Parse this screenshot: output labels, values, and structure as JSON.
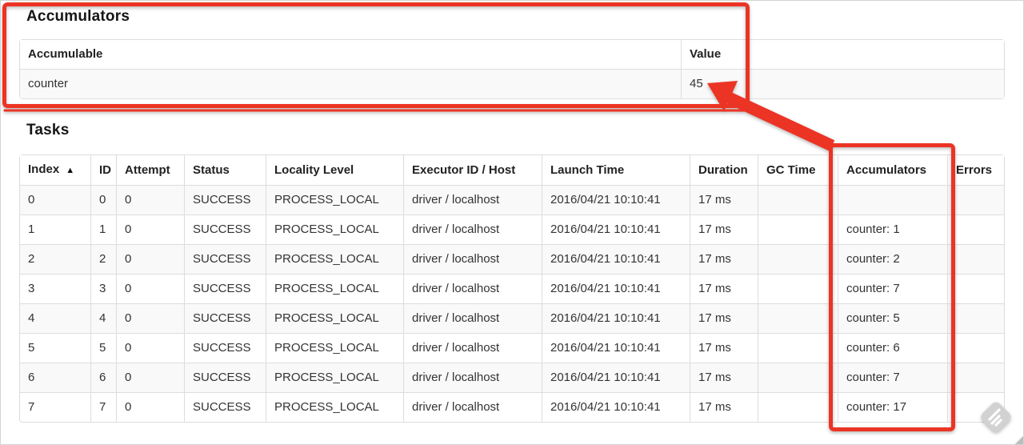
{
  "accumulators_section": {
    "heading": "Accumulators",
    "table": {
      "headers": {
        "accumulable": "Accumulable",
        "value": "Value"
      },
      "rows": [
        {
          "accumulable": "counter",
          "value": "45"
        }
      ]
    }
  },
  "tasks_section": {
    "heading": "Tasks",
    "table": {
      "sort_icon": "▲",
      "headers": {
        "index": "Index",
        "id": "ID",
        "attempt": "Attempt",
        "status": "Status",
        "locality": "Locality Level",
        "executor": "Executor ID / Host",
        "launch": "Launch Time",
        "duration": "Duration",
        "gc": "GC Time",
        "accum": "Accumulators",
        "errors": "Errors"
      },
      "rows": [
        {
          "index": "0",
          "id": "0",
          "attempt": "0",
          "status": "SUCCESS",
          "locality": "PROCESS_LOCAL",
          "executor": "driver / localhost",
          "launch": "2016/04/21 10:10:41",
          "duration": "17 ms",
          "gc": "",
          "accum": "",
          "errors": ""
        },
        {
          "index": "1",
          "id": "1",
          "attempt": "0",
          "status": "SUCCESS",
          "locality": "PROCESS_LOCAL",
          "executor": "driver / localhost",
          "launch": "2016/04/21 10:10:41",
          "duration": "17 ms",
          "gc": "",
          "accum": "counter: 1",
          "errors": ""
        },
        {
          "index": "2",
          "id": "2",
          "attempt": "0",
          "status": "SUCCESS",
          "locality": "PROCESS_LOCAL",
          "executor": "driver / localhost",
          "launch": "2016/04/21 10:10:41",
          "duration": "17 ms",
          "gc": "",
          "accum": "counter: 2",
          "errors": ""
        },
        {
          "index": "3",
          "id": "3",
          "attempt": "0",
          "status": "SUCCESS",
          "locality": "PROCESS_LOCAL",
          "executor": "driver / localhost",
          "launch": "2016/04/21 10:10:41",
          "duration": "17 ms",
          "gc": "",
          "accum": "counter: 7",
          "errors": ""
        },
        {
          "index": "4",
          "id": "4",
          "attempt": "0",
          "status": "SUCCESS",
          "locality": "PROCESS_LOCAL",
          "executor": "driver / localhost",
          "launch": "2016/04/21 10:10:41",
          "duration": "17 ms",
          "gc": "",
          "accum": "counter: 5",
          "errors": ""
        },
        {
          "index": "5",
          "id": "5",
          "attempt": "0",
          "status": "SUCCESS",
          "locality": "PROCESS_LOCAL",
          "executor": "driver / localhost",
          "launch": "2016/04/21 10:10:41",
          "duration": "17 ms",
          "gc": "",
          "accum": "counter: 6",
          "errors": ""
        },
        {
          "index": "6",
          "id": "6",
          "attempt": "0",
          "status": "SUCCESS",
          "locality": "PROCESS_LOCAL",
          "executor": "driver / localhost",
          "launch": "2016/04/21 10:10:41",
          "duration": "17 ms",
          "gc": "",
          "accum": "counter: 7",
          "errors": ""
        },
        {
          "index": "7",
          "id": "7",
          "attempt": "0",
          "status": "SUCCESS",
          "locality": "PROCESS_LOCAL",
          "executor": "driver / localhost",
          "launch": "2016/04/21 10:10:41",
          "duration": "17 ms",
          "gc": "",
          "accum": "counter: 17",
          "errors": ""
        }
      ]
    }
  },
  "annotations": {
    "highlight_color": "#ec3424"
  },
  "colors": {
    "stripe": "#f9f9f9",
    "table_border": "#dddddd",
    "text": "#333333",
    "watermark": "#d2d2d2"
  }
}
